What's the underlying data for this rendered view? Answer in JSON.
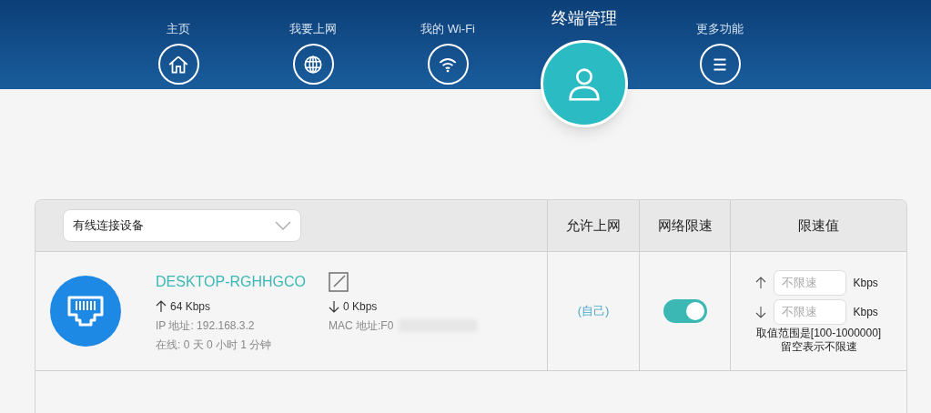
{
  "nav": [
    {
      "label": "主页",
      "selected": false
    },
    {
      "label": "我要上网",
      "selected": false
    },
    {
      "label": "我的 Wi-Fi",
      "selected": false
    },
    {
      "label": "终端管理",
      "selected": true
    },
    {
      "label": "更多功能",
      "selected": false
    }
  ],
  "filter": {
    "value": "有线连接设备"
  },
  "columns": [
    "允许上网",
    "网络限速",
    "限速值"
  ],
  "devices": [
    {
      "name": "DESKTOP-RGHHGCO",
      "upload": "64 Kbps",
      "download": "0 Kbps",
      "ip": "IP 地址: 192.168.3.2",
      "mac": "MAC 地址:F0",
      "mac_redacted": true,
      "online": "在线: 0 天 0 小时 1 分钟",
      "access": "(自己)",
      "limit_on": true,
      "limit_up": {
        "placeholder": "不限速",
        "unit": "Kbps"
      },
      "limit_down": {
        "placeholder": "不限速",
        "unit": "Kbps"
      },
      "hint": [
        "取值范围是[100-1000000]",
        "留空表示不限速"
      ]
    }
  ]
}
